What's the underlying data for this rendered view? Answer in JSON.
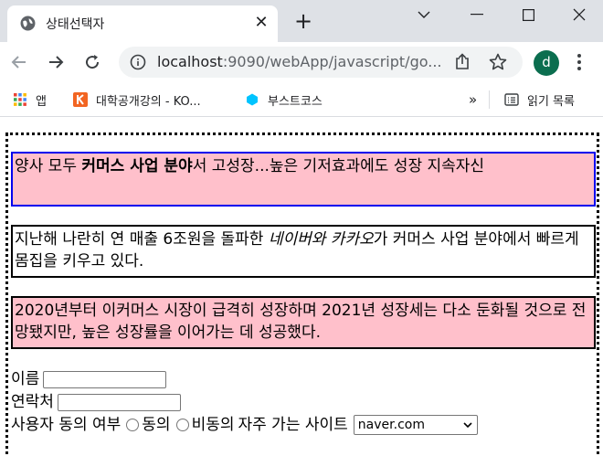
{
  "browser": {
    "tab_title": "상태선택자",
    "url_host": "localhost",
    "url_rest": ":9090/webApp/javascript/go...",
    "avatar_letter": "d",
    "avatar_color": "#0b6e4f"
  },
  "bookmarks": {
    "apps_label": "앱",
    "item1_label": "대학공개강의 - KO...",
    "item2_label": "부스트코스",
    "overflow_label": "»",
    "reading_list_label": "읽기 목록"
  },
  "content": {
    "p1": {
      "pre": "양사 모두 ",
      "bold": "커머스 사업 분야",
      "post": "서 고성장...높은 기저효과에도 성장 지속자신"
    },
    "p2": {
      "pre": "지난해 나란히 연 매출 6조원을 돌파한 ",
      "italic": "네이버와 카카오",
      "post": "가 커머스 사업 분야에서 빠르게 몸집을 키우고 있다."
    },
    "p3": {
      "text": "2020년부터 이커머스 시장이 급격히 성장하며 2021년 성장세는 다소 둔화될 것으로 전망됐지만, 높은 성장률을 이어가는 데 성공했다."
    }
  },
  "form": {
    "name_label": "이름",
    "contact_label": "연락처",
    "consent_label": "사용자 동의 여부",
    "agree_label": "동의",
    "disagree_label": "비동의",
    "site_label": "자주 가는 사이트",
    "site_selected": "naver.com"
  }
}
